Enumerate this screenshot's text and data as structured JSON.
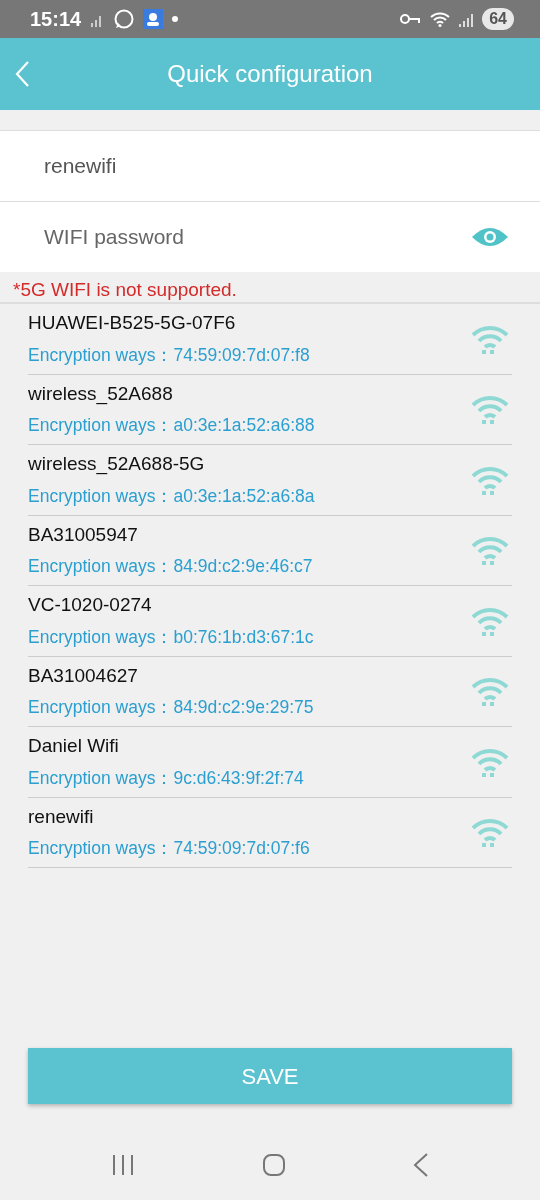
{
  "status_bar": {
    "time": "15:14",
    "battery": "64"
  },
  "header": {
    "title": "Quick configuration"
  },
  "ssid_field": {
    "value": "renewifi"
  },
  "password_field": {
    "placeholder": "WIFI password"
  },
  "warning": "*5G WIFI is not supported.",
  "networks": [
    {
      "name": "HUAWEI-B525-5G-07F6",
      "detail": "Encryption ways：74:59:09:7d:07:f8"
    },
    {
      "name": "wireless_52A688",
      "detail": "Encryption ways：a0:3e:1a:52:a6:88"
    },
    {
      "name": "wireless_52A688-5G",
      "detail": "Encryption ways：a0:3e:1a:52:a6:8a"
    },
    {
      "name": "BA31005947",
      "detail": "Encryption ways：84:9d:c2:9e:46:c7"
    },
    {
      "name": "VC-1020-0274",
      "detail": "Encryption ways：b0:76:1b:d3:67:1c"
    },
    {
      "name": "BA31004627",
      "detail": "Encryption ways：84:9d:c2:9e:29:75"
    },
    {
      "name": "Daniel Wifi",
      "detail": "Encryption ways：9c:d6:43:9f:2f:74"
    },
    {
      "name": "renewifi",
      "detail": "Encryption ways：74:59:09:7d:07:f6"
    }
  ],
  "save_button": "SAVE"
}
